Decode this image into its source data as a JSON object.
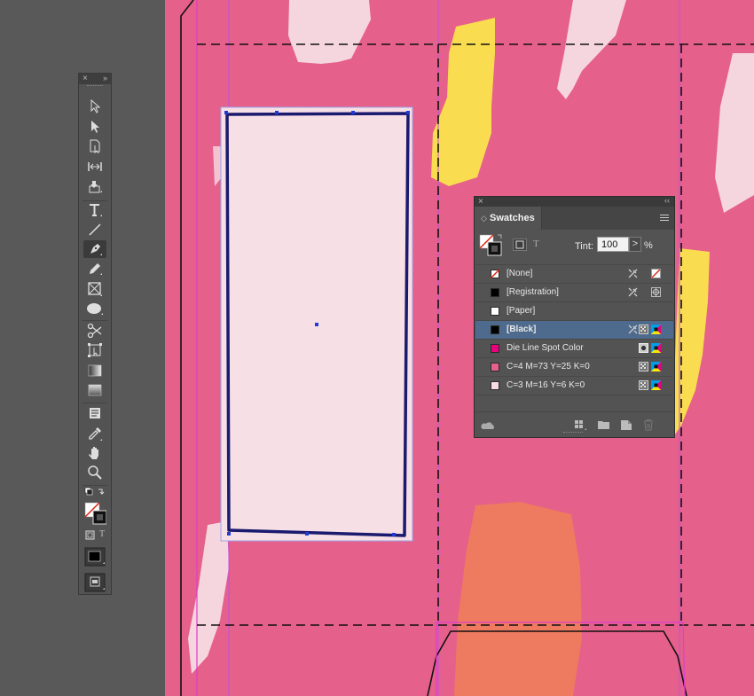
{
  "app": "Adobe InDesign",
  "tools_panel": {
    "close_glyph": "×",
    "collapse_glyph": "»",
    "tools": [
      {
        "name": "selection-tool-icon",
        "tooltip": "Selection Tool"
      },
      {
        "name": "direct-selection-tool-icon",
        "tooltip": "Direct Selection Tool"
      },
      {
        "name": "page-tool-icon",
        "tooltip": "Page Tool"
      },
      {
        "name": "gap-tool-icon",
        "tooltip": "Gap Tool"
      },
      {
        "name": "content-collector-tool-icon",
        "tooltip": "Content Collector Tool"
      },
      {
        "name": "type-tool-icon",
        "tooltip": "Type Tool"
      },
      {
        "name": "line-tool-icon",
        "tooltip": "Line Tool"
      },
      {
        "name": "pen-tool-icon",
        "tooltip": "Pen Tool",
        "selected": true
      },
      {
        "name": "pencil-tool-icon",
        "tooltip": "Pencil Tool"
      },
      {
        "name": "rectangle-frame-tool-icon",
        "tooltip": "Rectangle Frame Tool"
      },
      {
        "name": "ellipse-tool-icon",
        "tooltip": "Ellipse Tool"
      },
      {
        "name": "scissors-tool-icon",
        "tooltip": "Scissors Tool"
      },
      {
        "name": "free-transform-tool-icon",
        "tooltip": "Free Transform Tool"
      },
      {
        "name": "gradient-swatch-tool-icon",
        "tooltip": "Gradient Swatch Tool"
      },
      {
        "name": "gradient-feather-tool-icon",
        "tooltip": "Gradient Feather Tool"
      },
      {
        "name": "note-tool-icon",
        "tooltip": "Note Tool"
      },
      {
        "name": "eyedropper-tool-icon",
        "tooltip": "Eyedropper Tool"
      },
      {
        "name": "hand-tool-icon",
        "tooltip": "Hand Tool"
      },
      {
        "name": "zoom-tool-icon",
        "tooltip": "Zoom Tool"
      }
    ],
    "text_glyph": "T"
  },
  "swatches_panel": {
    "close_glyph": "×",
    "collapse_glyph": "‹‹",
    "tab_label": "Swatches",
    "tab_glyph": "◇",
    "text_glyph": "T",
    "tint_label": "Tint:",
    "tint_value": "100",
    "tint_arrow": ">",
    "percent": "%",
    "swatches": [
      {
        "name": "[None]",
        "color": "none",
        "icons": [
          "no-edit-icon",
          "none-swatch-icon"
        ]
      },
      {
        "name": "[Registration]",
        "color": "#000000",
        "icons": [
          "no-edit-icon",
          "registration-icon"
        ]
      },
      {
        "name": "[Paper]",
        "color": "#ffffff",
        "icons": []
      },
      {
        "name": "[Black]",
        "color": "#000000",
        "selected": true,
        "icons": [
          "no-edit-icon",
          "process-icon",
          "cmyk-icon"
        ]
      },
      {
        "name": "Die Line Spot Color",
        "color": "#e6007e",
        "icons": [
          "spot-icon",
          "cmyk-icon"
        ]
      },
      {
        "name": "C=4 M=73 Y=25 K=0",
        "color": "#e5608a",
        "icons": [
          "process-icon",
          "cmyk-icon"
        ]
      },
      {
        "name": "C=3 M=16 Y=6 K=0",
        "color": "#f6dbe3",
        "icons": [
          "process-icon",
          "cmyk-icon"
        ]
      }
    ]
  },
  "colors": {
    "canvas": "#e5608a",
    "frame_fill": "#f7dfe6",
    "frame_stroke": "#1a1a6e",
    "margin_guide": "#e03ccb",
    "yellow": "#f9dc50",
    "orange": "#ee7a60",
    "selection_blue": "#4e6a8c"
  }
}
